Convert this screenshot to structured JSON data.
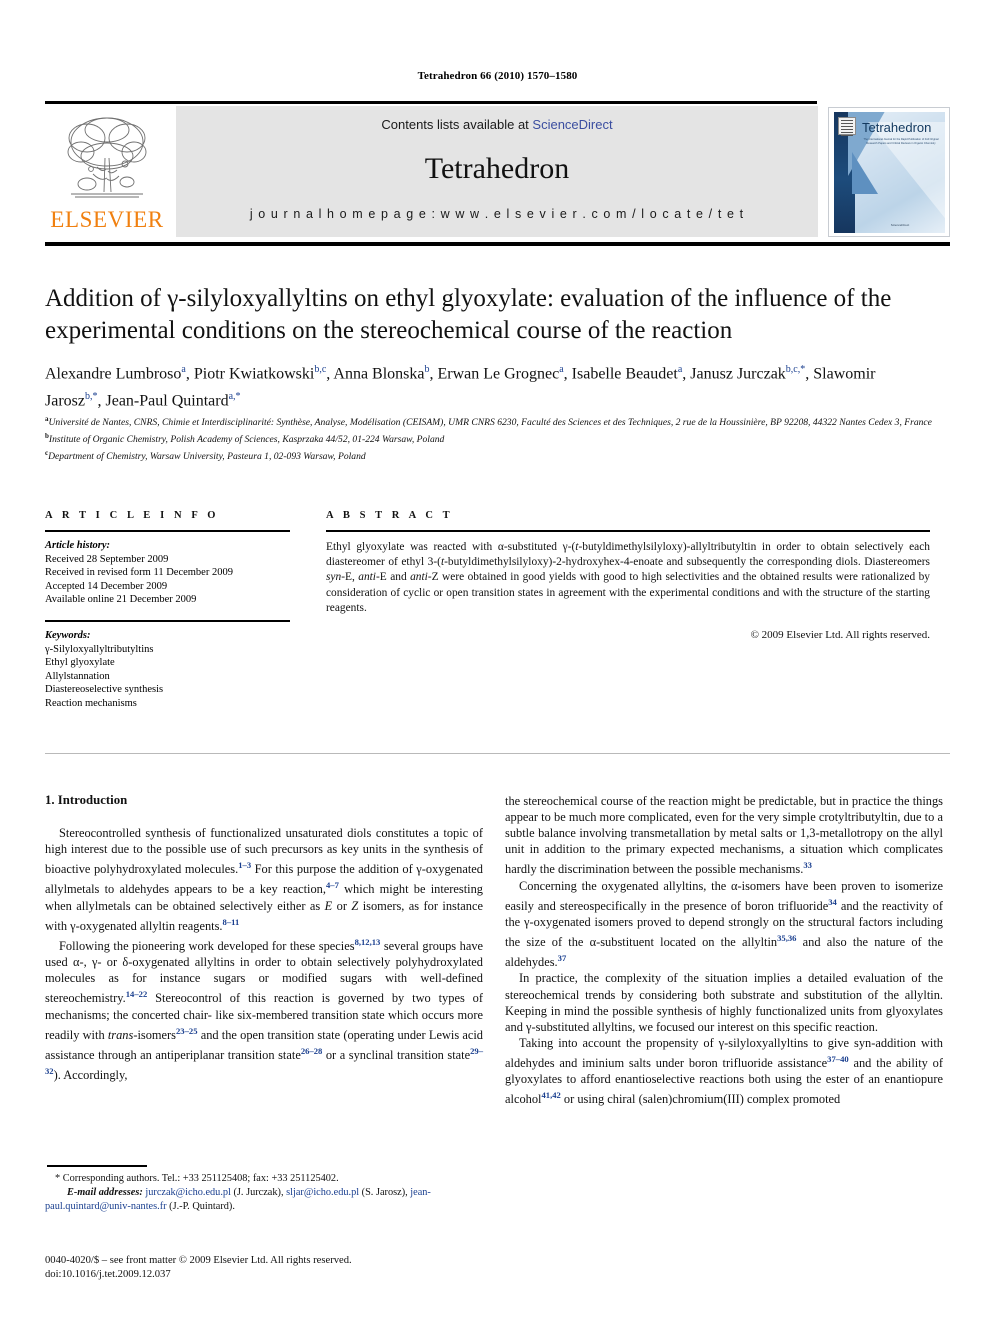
{
  "running_head": "Tetrahedron 66 (2010) 1570–1580",
  "masthead": {
    "publisher_logo_text": "ELSEVIER",
    "contents_prefix": "Contents lists available at ",
    "contents_link": "ScienceDirect",
    "journal_name": "Tetrahedron",
    "homepage": "j o u r n a l   h o m e p a g e :   w w w . e l s e v i e r . c o m / l o c a t e / t e t",
    "cover": {
      "title": "Tetrahedron",
      "subtitle": "The International Journal for the Rapid Publication of Full Original Research Papers and Critical Reviews in Organic Chemistry",
      "footer": "ScienceDirect"
    }
  },
  "article": {
    "title": "Addition of γ-silyloxyallyltins on ethyl glyoxylate: evaluation of the influence of the experimental conditions on the stereochemical course of the reaction",
    "authors_html": "Alexandre Lumbroso<sup>a</sup>, Piotr Kwiatkowski<sup>b,c</sup>, Anna Blonska<sup>b</sup>, Erwan Le Grognec<sup>a</sup>, Isabelle Beaudet<sup>a</sup>, Janusz Jurczak<sup>b,c,*</sup>, Slawomir Jarosz<sup>b,*</sup>, Jean-Paul Quintard<sup>a,*</sup>",
    "affiliations": [
      "Université de Nantes, CNRS, Chimie et Interdisciplinarité: Synthèse, Analyse, Modélisation (CEISAM), UMR CNRS 6230, Faculté des Sciences et des Techniques, 2 rue de la Houssinière, BP 92208, 44322 Nantes Cedex 3, France",
      "Institute of Organic Chemistry, Polish Academy of Sciences, Kasprzaka 44/52, 01-224 Warsaw, Poland",
      "Department of Chemistry, Warsaw University, Pasteura 1, 02-093 Warsaw, Poland"
    ],
    "affiliation_markers": [
      "a",
      "b",
      "c"
    ]
  },
  "article_info": {
    "heading": "A R T I C L E   I N F O",
    "history_label": "Article history:",
    "history": [
      "Received 28 September 2009",
      "Received in revised form 11 December 2009",
      "Accepted 14 December 2009",
      "Available online 21 December 2009"
    ],
    "keywords_label": "Keywords:",
    "keywords": [
      "γ-Silyloxyallyltributyltins",
      "Ethyl glyoxylate",
      "Allylstannation",
      "Diastereoselective synthesis",
      "Reaction mechanisms"
    ]
  },
  "abstract": {
    "heading": "A B S T R A C T",
    "text_html": "Ethyl glyoxylate was reacted with α-substituted γ-(<i>t</i>-butyldimethylsilyloxy)-allyltributyltin in order to obtain selectively each diastereomer of ethyl 3-(<i>t</i>-butyldimethylsilyloxy)-2-hydroxyhex-4-enoate and subsequently the corresponding diols. Diastereomers <i>syn</i>-E, <i>anti</i>-E and <i>anti</i>-Z were obtained in good yields with good to high selectivities and the obtained results were rationalized by consideration of cyclic or open transition states in agreement with the experimental conditions and with the structure of the starting reagents.",
    "copyright": "© 2009 Elsevier Ltd. All rights reserved."
  },
  "body": {
    "section_heading": "1. Introduction",
    "left_paragraphs_html": [
      "Stereocontrolled synthesis of functionalized unsaturated diols constitutes a topic of high interest due to the possible use of such precursors as key units in the synthesis of bioactive polyhydroxylated molecules.<sup>1–3</sup> For this purpose the addition of γ-oxygenated allylmetals to aldehydes appears to be a key reaction,<sup>4–7</sup> which might be interesting when allylmetals can be obtained selectively either as <i>E</i> or <i>Z</i> isomers, as for instance with γ-oxygenated allyltin reagents.<sup>8–11</sup>",
      "Following the pioneering work developed for these species<sup>8,12,13</sup> several groups have used α-, γ- or δ-oxygenated allyltins in order to obtain selectively polyhydroxylated molecules as for instance sugars or modified sugars with well-defined stereochemistry.<sup>14–22</sup> Stereocontrol of this reaction is governed by two types of mechanisms; the concerted chair- like six-membered transition state which occurs more readily with <i>trans</i>-isomers<sup>23–25</sup> and the open transition state (operating under Lewis acid assistance through an antiperiplanar transition state<sup>26–28</sup> or a synclinal transition state<sup>29–32</sup>). Accordingly,"
    ],
    "right_paragraphs_html": [
      "the stereochemical course of the reaction might be predictable, but in practice the things appear to be much more complicated, even for the very simple crotyltributyltin, due to a subtle balance involving transmetallation by metal salts or 1,3-metallotropy on the allyl unit in addition to the primary expected mechanisms, a situation which complicates hardly the discrimination between the possible mechanisms.<sup>33</sup>",
      "Concerning the oxygenated allyltins, the α-isomers have been proven to isomerize easily and stereospecifically in the presence of boron trifluoride<sup>34</sup> and the reactivity of the γ-oxygenated isomers proved to depend strongly on the structural factors including the size of the α-substituent located on the allyltin<sup>35,36</sup> and also the nature of the aldehydes.<sup>37</sup>",
      "In practice, the complexity of the situation implies a detailed evaluation of the stereochemical trends by considering both substrate and substitution of the allyltin. Keeping in mind the possible synthesis of highly functionalized units from glyoxylates and γ-substituted allyltins, we focused our interest on this specific reaction.",
      "Taking into account the propensity of γ-silyloxyallyltins to give syn-addition with aldehydes and iminium salts under boron trifluoride assistance<sup>37–40</sup> and the ability of glyoxylates to afford enantioselective reactions both using the ester of an enantiopure alcohol<sup>41,42</sup> or using chiral (salen)chromium(III) complex promoted"
    ]
  },
  "footnote": {
    "corresponding_html": "<span class=\"star\">*</span> Corresponding authors. Tel.: +33 251125408; fax: +33 251125402.",
    "email_label": "E-mail addresses:",
    "emails_html": "<span class=\"mail\">jurczak@icho.edu.pl</span> (J. Jurczak), <span class=\"mail\">sljar@icho.edu.pl</span> (S. Jarosz), <span class=\"mail\">jean-paul.quintard@univ-nantes.fr</span> (J.-P. Quintard)."
  },
  "imprint": {
    "issn_line": "0040-4020/$ – see front matter © 2009 Elsevier Ltd. All rights reserved.",
    "doi_line": "doi:10.1016/j.tet.2009.12.037"
  },
  "colors": {
    "link_blue": "#3b4ea0",
    "elsevier_orange": "#f08010",
    "superscript_blue": "#1a3f8f",
    "band_gray": "#e4e4e4"
  }
}
